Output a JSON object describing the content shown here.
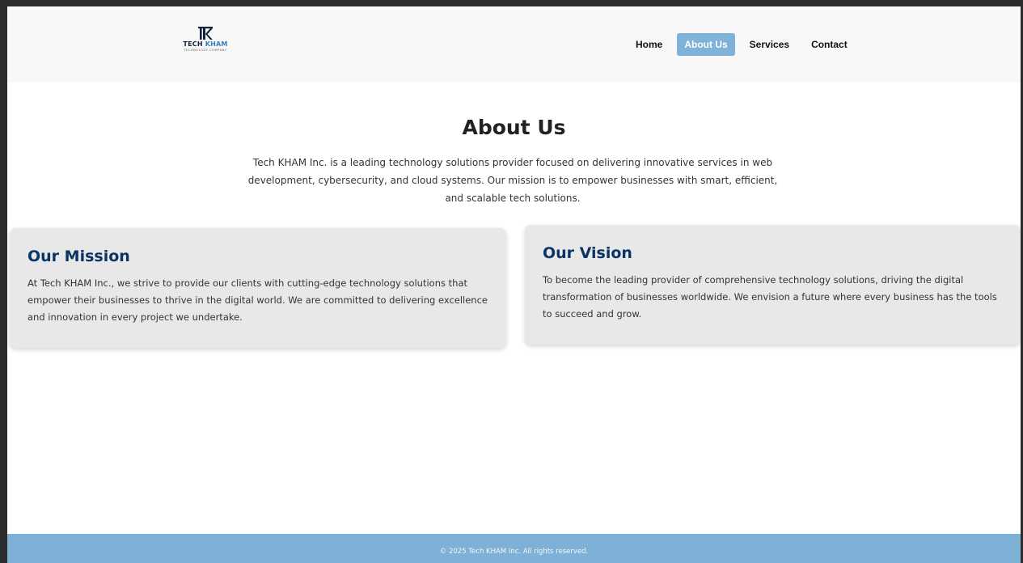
{
  "brand": {
    "logo_name_prefix": "TECH",
    "logo_name_accent": "KHAM",
    "logo_tagline": "TECHNOLOGY COMPANY",
    "primary_color": "#0b3466",
    "accent_color": "#7eb2d8"
  },
  "nav": {
    "items": [
      {
        "label": "Home",
        "active": false
      },
      {
        "label": "About Us",
        "active": true
      },
      {
        "label": "Services",
        "active": false
      },
      {
        "label": "Contact",
        "active": false
      }
    ]
  },
  "main": {
    "title": "About Us",
    "intro": "Tech KHAM Inc. is a leading technology solutions provider focused on delivering innovative services in web development, cybersecurity, and cloud systems. Our mission is to empower businesses with smart, efficient, and scalable tech solutions."
  },
  "cards": {
    "mission": {
      "title": "Our Mission",
      "text": "At Tech KHAM Inc., we strive to provide our clients with cutting-edge technology solutions that empower their businesses to thrive in the digital world. We are committed to delivering excellence and innovation in every project we undertake."
    },
    "vision": {
      "title": "Our Vision",
      "text": "To become the leading provider of comprehensive technology solutions, driving the digital transformation of businesses worldwide. We envision a future where every business has the tools to succeed and grow."
    }
  },
  "footer": {
    "text": "© 2025 Tech KHAM Inc. All rights reserved."
  }
}
